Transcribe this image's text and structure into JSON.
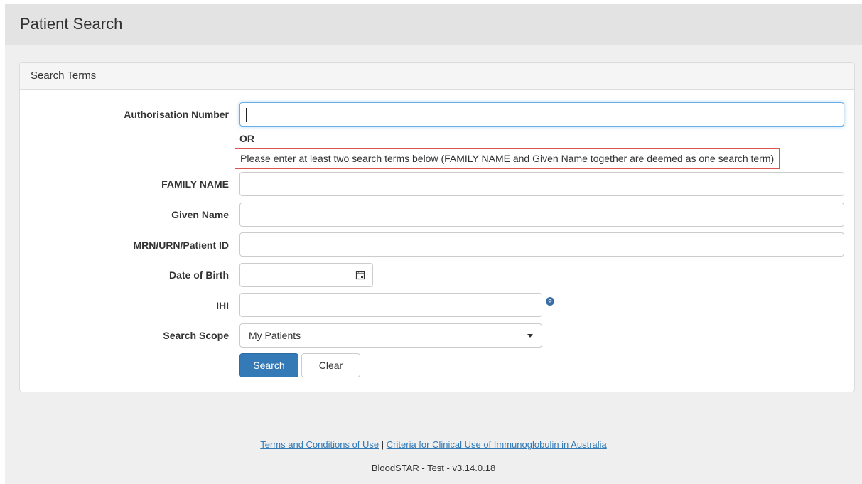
{
  "header": {
    "title": "Patient Search"
  },
  "panel": {
    "title": "Search Terms"
  },
  "form": {
    "authorisation_number": {
      "label": "Authorisation Number",
      "value": ""
    },
    "or_text": "OR",
    "notice": "Please enter at least two search terms below (FAMILY NAME and Given Name together are deemed as one search term)",
    "family_name": {
      "label": "FAMILY NAME",
      "value": ""
    },
    "given_name": {
      "label": "Given Name",
      "value": ""
    },
    "mrn": {
      "label": "MRN/URN/Patient ID",
      "value": ""
    },
    "dob": {
      "label": "Date of Birth",
      "value": ""
    },
    "ihi": {
      "label": "IHI",
      "value": "",
      "help_icon": "question-circle-icon"
    },
    "search_scope": {
      "label": "Search Scope",
      "selected": "My Patients"
    },
    "search_button": "Search",
    "clear_button": "Clear"
  },
  "footer": {
    "link_terms": "Terms and Conditions of Use",
    "separator": "|",
    "link_criteria": "Criteria for Clinical Use of Immunoglobulin in Australia",
    "version": "BloodSTAR - Test - v3.14.0.18"
  },
  "colors": {
    "primary": "#337ab7",
    "notice_border": "#d9534f",
    "focus_border": "#66afe9"
  }
}
